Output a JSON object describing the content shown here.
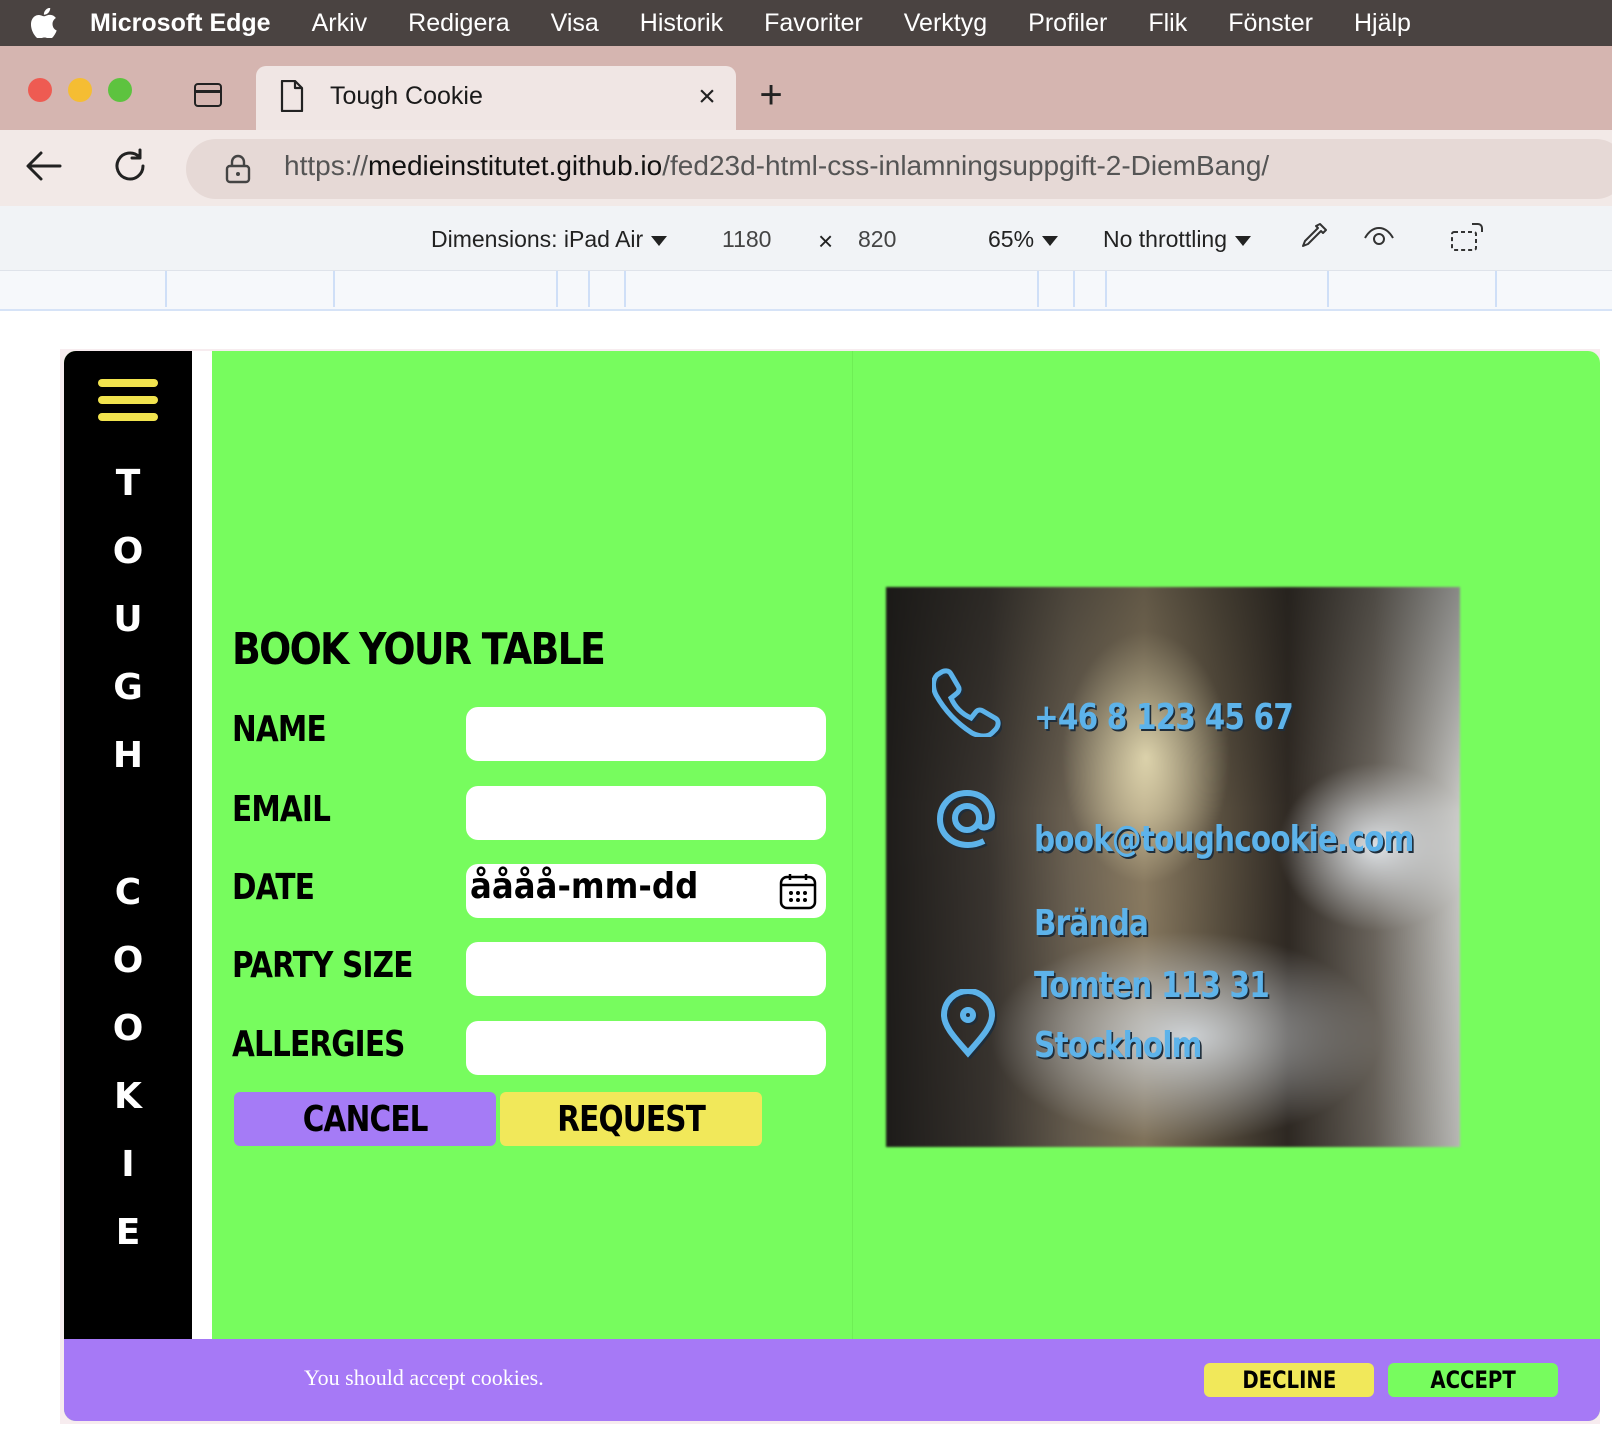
{
  "menubar": {
    "app_name": "Microsoft Edge",
    "items": [
      "Arkiv",
      "Redigera",
      "Visa",
      "Historik",
      "Favoriter",
      "Verktyg",
      "Profiler",
      "Flik",
      "Fönster",
      "Hjälp"
    ]
  },
  "browser": {
    "tab_title": "Tough Cookie",
    "url_prefix": "https://",
    "url_host": "medieinstitutet.github.io",
    "url_path": "/fed23d-html-css-inlamningsuppgift-2-DiemBang/"
  },
  "devtools": {
    "dimensions_label": "Dimensions: iPad Air",
    "width": "1180",
    "times": "×",
    "height": "820",
    "zoom": "65%",
    "throttling": "No throttling"
  },
  "site": {
    "brand_letters": [
      "T",
      "O",
      "U",
      "G",
      "H",
      "C",
      "O",
      "O",
      "K",
      "I",
      "E"
    ],
    "heading": "BOOK YOUR TABLE",
    "form": {
      "name_label": "NAME",
      "email_label": "EMAIL",
      "date_label": "DATE",
      "date_placeholder": "åååå-mm-dd",
      "party_label": "PARTY SIZE",
      "allergies_label": "ALLERGIES",
      "cancel": "CANCEL",
      "request": "REQUEST"
    },
    "contact": {
      "phone": "+46 8 123 45 67",
      "email": "book@toughcookie.com",
      "address_lines": [
        "Brända",
        "Tomten 113 31",
        "Stockholm"
      ]
    },
    "cookies": {
      "message": "You should accept cookies.",
      "decline": "DECLINE",
      "accept": "ACCEPT"
    },
    "colors": {
      "green": "#77fc5e",
      "purple": "#a679f6",
      "yellow": "#f1e85a",
      "contact_blue": "#5db3ea"
    }
  }
}
